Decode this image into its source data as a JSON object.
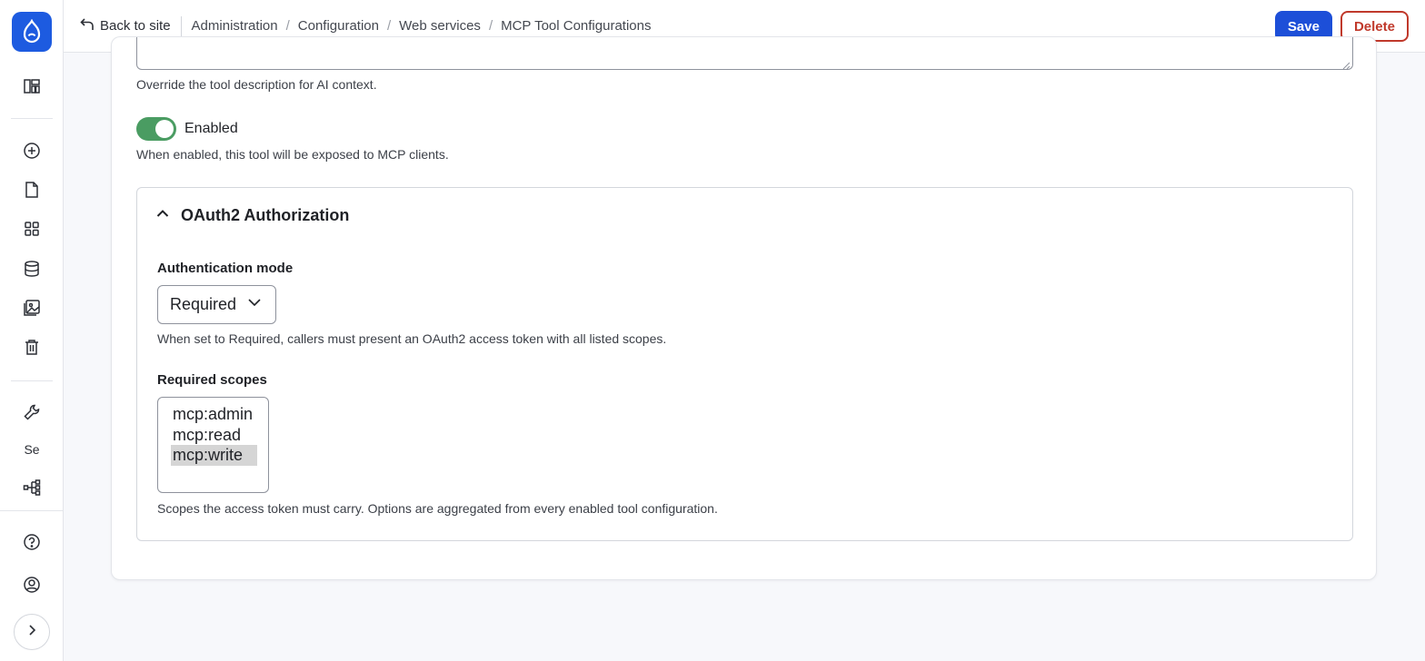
{
  "topbar": {
    "back_label": "Back to site",
    "breadcrumbs": [
      "Administration",
      "Configuration",
      "Web services"
    ],
    "current": "MCP Tool Configurations",
    "save_label": "Save",
    "delete_label": "Delete"
  },
  "sidebar": {
    "items": [
      {
        "icon": "dashboard-icon"
      },
      {
        "icon": "add-content-icon"
      },
      {
        "icon": "content-icon"
      },
      {
        "icon": "structure-icon"
      },
      {
        "icon": "database-icon"
      },
      {
        "icon": "media-icon"
      },
      {
        "icon": "trash-icon"
      },
      {
        "icon": "wrench-icon"
      },
      {
        "text": "Se"
      },
      {
        "icon": "workflow-icon"
      },
      {
        "icon": "help-icon"
      },
      {
        "icon": "user-icon"
      },
      {
        "icon": "expand-icon"
      }
    ]
  },
  "form": {
    "description_help": "Override the tool description for AI context.",
    "enabled_label": "Enabled",
    "enabled_value": true,
    "enabled_help": "When enabled, this tool will be exposed to MCP clients.",
    "oauth": {
      "title": "OAuth2 Authorization",
      "auth_mode_label": "Authentication mode",
      "auth_mode_value": "Required",
      "auth_mode_help": "When set to Required, callers must present an OAuth2 access token with all listed scopes.",
      "scopes_label": "Required scopes",
      "scopes": [
        {
          "label": "mcp:admin",
          "selected": false
        },
        {
          "label": "mcp:read",
          "selected": false
        },
        {
          "label": "mcp:write",
          "selected": true
        }
      ],
      "scopes_help": "Scopes the access token must carry. Options are aggregated from every enabled tool configuration."
    }
  },
  "colors": {
    "primary": "#1d4fd8",
    "danger": "#c0392b",
    "toggle_on": "#4a9c62",
    "logo": "#1d5be0"
  }
}
